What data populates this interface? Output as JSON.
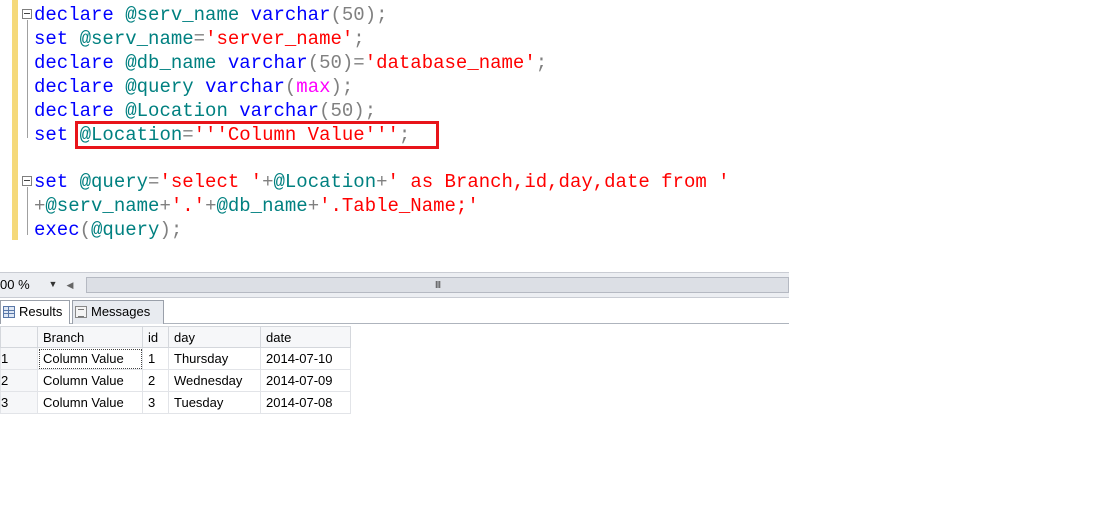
{
  "editor": {
    "lines": [
      [
        {
          "t": "declare",
          "c": "kw"
        },
        {
          "t": " ",
          "c": ""
        },
        {
          "t": "@serv_name",
          "c": "var"
        },
        {
          "t": " ",
          "c": ""
        },
        {
          "t": "varchar",
          "c": "kw"
        },
        {
          "t": "(50);",
          "c": "gray"
        }
      ],
      [
        {
          "t": "set",
          "c": "kw"
        },
        {
          "t": " ",
          "c": ""
        },
        {
          "t": "@serv_name",
          "c": "var"
        },
        {
          "t": "=",
          "c": "gray"
        },
        {
          "t": "'server_name'",
          "c": "str"
        },
        {
          "t": ";",
          "c": "gray"
        }
      ],
      [
        {
          "t": "declare",
          "c": "kw"
        },
        {
          "t": " ",
          "c": ""
        },
        {
          "t": "@db_name",
          "c": "var"
        },
        {
          "t": " ",
          "c": ""
        },
        {
          "t": "varchar",
          "c": "kw"
        },
        {
          "t": "(50)=",
          "c": "gray"
        },
        {
          "t": "'database_name'",
          "c": "str"
        },
        {
          "t": ";",
          "c": "gray"
        }
      ],
      [
        {
          "t": "declare",
          "c": "kw"
        },
        {
          "t": " ",
          "c": ""
        },
        {
          "t": "@query",
          "c": "var"
        },
        {
          "t": " ",
          "c": ""
        },
        {
          "t": "varchar",
          "c": "kw"
        },
        {
          "t": "(",
          "c": "gray"
        },
        {
          "t": "max",
          "c": "fn"
        },
        {
          "t": ");",
          "c": "gray"
        }
      ],
      [
        {
          "t": "declare",
          "c": "kw"
        },
        {
          "t": " ",
          "c": ""
        },
        {
          "t": "@Location",
          "c": "var"
        },
        {
          "t": " ",
          "c": ""
        },
        {
          "t": "varchar",
          "c": "kw"
        },
        {
          "t": "(50);",
          "c": "gray"
        }
      ],
      [
        {
          "t": "set",
          "c": "kw"
        },
        {
          "t": " ",
          "c": ""
        },
        {
          "t": "@Location",
          "c": "var"
        },
        {
          "t": "=",
          "c": "gray"
        },
        {
          "t": "'''Column Value'''",
          "c": "str"
        },
        {
          "t": ";",
          "c": "gray"
        }
      ],
      [],
      [
        {
          "t": "set",
          "c": "kw"
        },
        {
          "t": " ",
          "c": ""
        },
        {
          "t": "@query",
          "c": "var"
        },
        {
          "t": "=",
          "c": "gray"
        },
        {
          "t": "'select '",
          "c": "str"
        },
        {
          "t": "+",
          "c": "gray"
        },
        {
          "t": "@Location",
          "c": "var"
        },
        {
          "t": "+",
          "c": "gray"
        },
        {
          "t": "' as Branch,id,day,date from '",
          "c": "str"
        }
      ],
      [
        {
          "t": "+",
          "c": "gray"
        },
        {
          "t": "@serv_name",
          "c": "var"
        },
        {
          "t": "+",
          "c": "gray"
        },
        {
          "t": "'.'",
          "c": "str"
        },
        {
          "t": "+",
          "c": "gray"
        },
        {
          "t": "@db_name",
          "c": "var"
        },
        {
          "t": "+",
          "c": "gray"
        },
        {
          "t": "'.Table_Name;'",
          "c": "str"
        }
      ],
      [
        {
          "t": "exec",
          "c": "kw"
        },
        {
          "t": "(",
          "c": "gray"
        },
        {
          "t": "@query",
          "c": "var"
        },
        {
          "t": ");",
          "c": "gray"
        }
      ]
    ]
  },
  "zoom": {
    "value": "00 %"
  },
  "scrollbar": {
    "grip": "III"
  },
  "tabs": {
    "results": "Results",
    "messages": "Messages"
  },
  "grid": {
    "columns": [
      "Branch",
      "id",
      "day",
      "date"
    ],
    "rows": [
      {
        "num": "1",
        "cells": [
          "Column Value",
          "1",
          "Thursday",
          "2014-07-10"
        ]
      },
      {
        "num": "2",
        "cells": [
          "Column Value",
          "2",
          "Wednesday",
          "2014-07-09"
        ]
      },
      {
        "num": "3",
        "cells": [
          "Column Value",
          "3",
          "Tuesday",
          "2014-07-08"
        ]
      }
    ]
  },
  "colors": {
    "keyword": "#0000ff",
    "variable": "#008080",
    "string": "#ff0000",
    "operator": "#808080",
    "function": "#ff00ff",
    "highlight": "#e8141a",
    "margin": "#f5d97a"
  }
}
